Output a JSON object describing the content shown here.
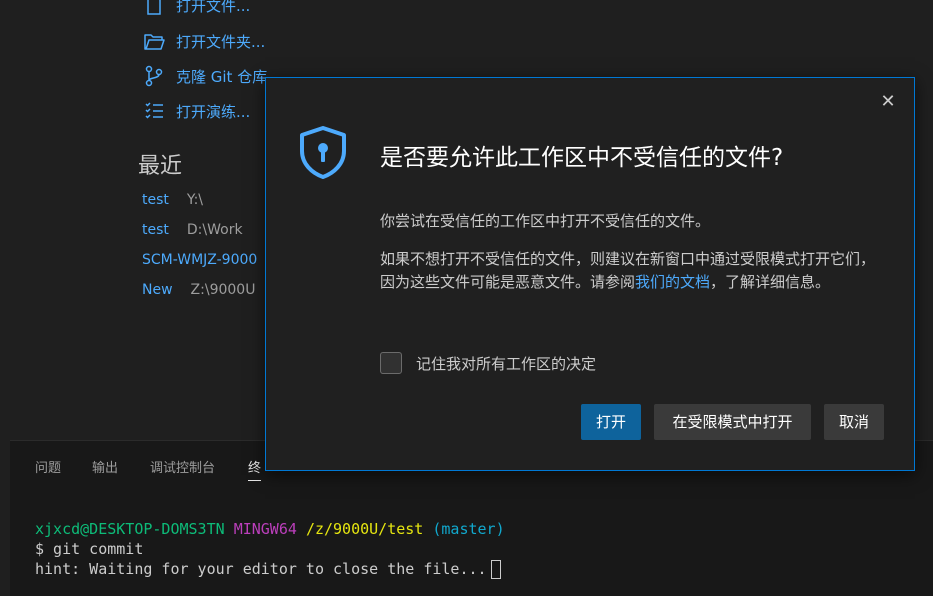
{
  "start": {
    "items": [
      {
        "label": "打开文件...",
        "icon": "file-icon"
      },
      {
        "label": "打开文件夹...",
        "icon": "folder-open-icon"
      },
      {
        "label": "克隆 Git 仓库",
        "icon": "git-branch-icon"
      },
      {
        "label": "打开演练...",
        "icon": "checklist-icon"
      }
    ]
  },
  "recent": {
    "title": "最近",
    "items": [
      {
        "name": "test",
        "path": "Y:\\"
      },
      {
        "name": "test",
        "path": "D:\\Work"
      },
      {
        "name": "SCM-WMJZ-9000",
        "path": ""
      },
      {
        "name": "New",
        "path": "Z:\\9000U"
      }
    ]
  },
  "panel": {
    "tabs": [
      "问题",
      "输出",
      "调试控制台",
      "终"
    ],
    "terminal": {
      "user": "xjxcd@DESKTOP-DOMS3TN",
      "env": "MINGW64",
      "path": "/z/9000U/test",
      "branch": "(master)",
      "line2": "$ git commit",
      "line3": "hint: Waiting for your editor to close the file..."
    }
  },
  "dialog": {
    "title": "是否要允许此工作区中不受信任的文件?",
    "message": "你尝试在受信任的工作区中打开不受信任的文件。",
    "detail_before": "如果不想打开不受信任的文件，则建议在新窗口中通过受限模式打开它们，因为这些文件可能是恶意文件。请参阅",
    "detail_link": "我们的文档",
    "detail_after": "，了解详细信息。",
    "checkbox_label": "记住我对所有工作区的决定",
    "buttons": {
      "open": "打开",
      "open_restricted": "在受限模式中打开",
      "cancel": "取消"
    },
    "close_glyph": "✕"
  },
  "colors": {
    "accent": "#0078d4",
    "link": "#4daafc",
    "primary_button": "#0e639c"
  }
}
